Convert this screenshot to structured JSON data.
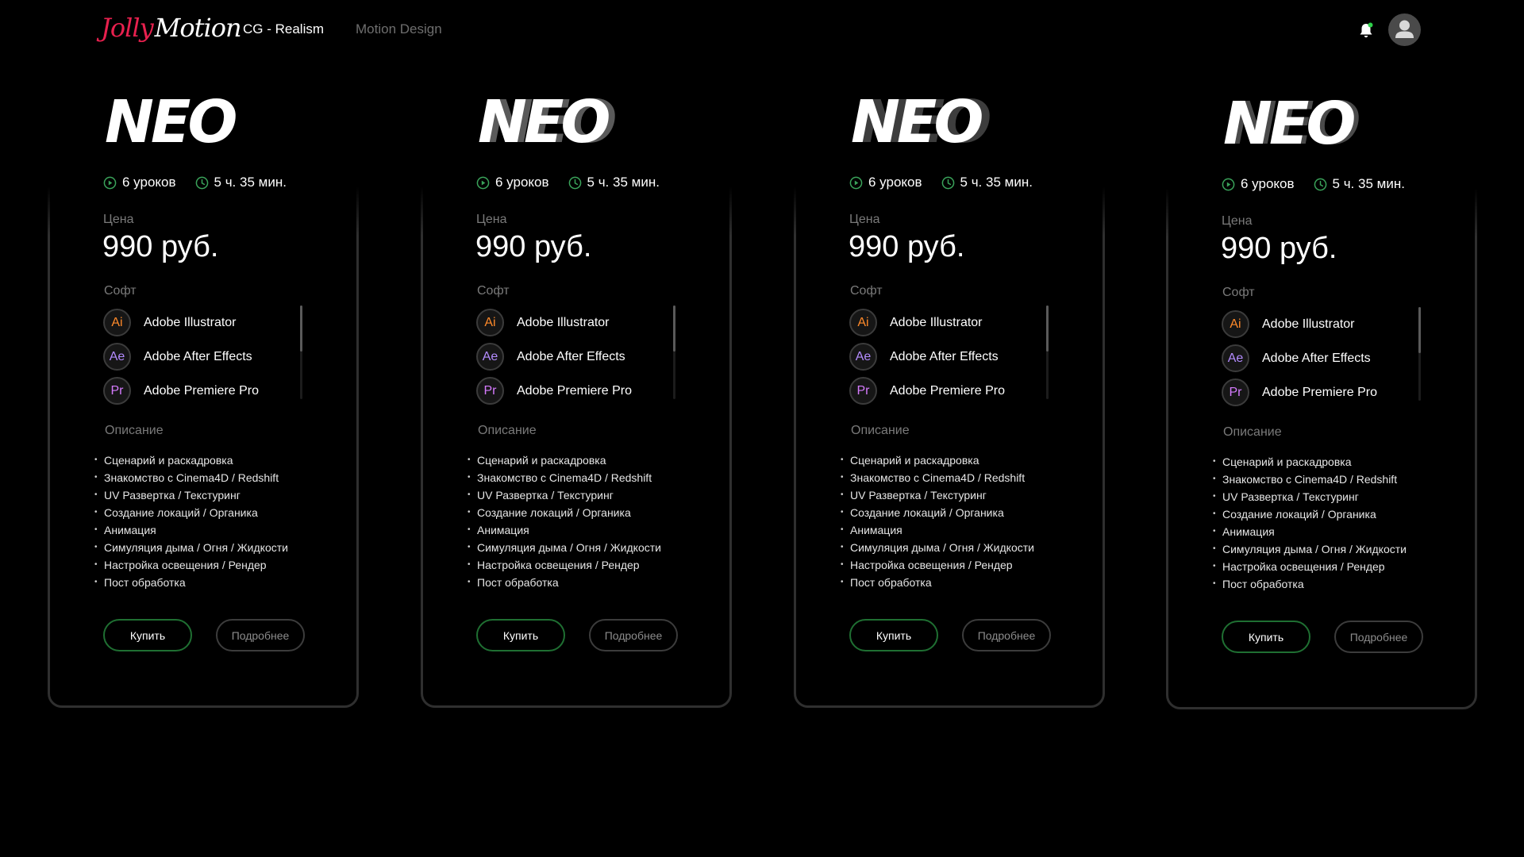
{
  "brand": {
    "logo_part1": "Jolly",
    "logo_part2": "Motion",
    "accent": "#e8204e"
  },
  "nav": {
    "items": [
      {
        "label": "CG - Realism"
      },
      {
        "label": "Motion Design"
      }
    ]
  },
  "header": {
    "bell_icon": "bell-icon",
    "avatar_icon": "user-icon",
    "notification_dot_color": "#2ed14a"
  },
  "cards": [
    {
      "title": "NEO",
      "lessons": "6 уроков",
      "duration": "5 ч. 35 мин.",
      "price_label": "Цена",
      "price": "990 руб.",
      "soft_label": "Софт",
      "software": [
        {
          "abbr": "Ai",
          "name": "Adobe Illustrator",
          "color": "#ff8a2a"
        },
        {
          "abbr": "Ae",
          "name": "Adobe After Effects",
          "color": "#b48cff"
        },
        {
          "abbr": "Pr",
          "name": "Adobe Premiere Pro",
          "color": "#d67bff"
        }
      ],
      "desc_label": "Описание",
      "description": [
        "Сценарий и раскадровка",
        "Знакомство с Cinema4D / Redshift",
        "UV Развертка / Текстуринг",
        "Создание локаций / Органика",
        "Анимация",
        "Симуляция дыма / Огня / Жидкости",
        "Настройка освещения / Рендер",
        "Пост обработка"
      ],
      "buy_label": "Купить",
      "more_label": "Подробнее"
    },
    {
      "title": "NEO",
      "lessons": "6 уроков",
      "duration": "5 ч. 35 мин.",
      "price_label": "Цена",
      "price": "990 руб.",
      "soft_label": "Софт",
      "software": [
        {
          "abbr": "Ai",
          "name": "Adobe Illustrator",
          "color": "#ff8a2a"
        },
        {
          "abbr": "Ae",
          "name": "Adobe After Effects",
          "color": "#b48cff"
        },
        {
          "abbr": "Pr",
          "name": "Adobe Premiere Pro",
          "color": "#d67bff"
        }
      ],
      "desc_label": "Описание",
      "description": [
        "Сценарий и раскадровка",
        "Знакомство с Cinema4D / Redshift",
        "UV Развертка / Текстуринг",
        "Создание локаций / Органика",
        "Анимация",
        "Симуляция дыма / Огня / Жидкости",
        "Настройка освещения / Рендер",
        "Пост обработка"
      ],
      "buy_label": "Купить",
      "more_label": "Подробнее"
    },
    {
      "title": "NEO",
      "lessons": "6 уроков",
      "duration": "5 ч. 35 мин.",
      "price_label": "Цена",
      "price": "990 руб.",
      "soft_label": "Софт",
      "software": [
        {
          "abbr": "Ai",
          "name": "Adobe Illustrator",
          "color": "#ff8a2a"
        },
        {
          "abbr": "Ae",
          "name": "Adobe After Effects",
          "color": "#b48cff"
        },
        {
          "abbr": "Pr",
          "name": "Adobe Premiere Pro",
          "color": "#d67bff"
        }
      ],
      "desc_label": "Описание",
      "description": [
        "Сценарий и раскадровка",
        "Знакомство с Cinema4D / Redshift",
        "UV Развертка / Текстуринг",
        "Создание локаций / Органика",
        "Анимация",
        "Симуляция дыма / Огня / Жидкости",
        "Настройка освещения / Рендер",
        "Пост обработка"
      ],
      "buy_label": "Купить",
      "more_label": "Подробнее"
    },
    {
      "title": "NEO",
      "lessons": "6 уроков",
      "duration": "5 ч. 35 мин.",
      "price_label": "Цена",
      "price": "990 руб.",
      "soft_label": "Софт",
      "software": [
        {
          "abbr": "Ai",
          "name": "Adobe Illustrator",
          "color": "#ff8a2a"
        },
        {
          "abbr": "Ae",
          "name": "Adobe After Effects",
          "color": "#b48cff"
        },
        {
          "abbr": "Pr",
          "name": "Adobe Premiere Pro",
          "color": "#d67bff"
        }
      ],
      "desc_label": "Описание",
      "description": [
        "Сценарий и раскадровка",
        "Знакомство с Cinema4D / Redshift",
        "UV Развертка / Текстуринг",
        "Создание локаций / Органика",
        "Анимация",
        "Симуляция дыма / Огня / Жидкости",
        "Настройка освещения / Рендер",
        "Пост обработка"
      ],
      "buy_label": "Купить",
      "more_label": "Подробнее"
    }
  ],
  "colors": {
    "icon_green": "#3aa35a",
    "button_green_border": "#1f6f32",
    "card_border": "#2f2f2f"
  }
}
